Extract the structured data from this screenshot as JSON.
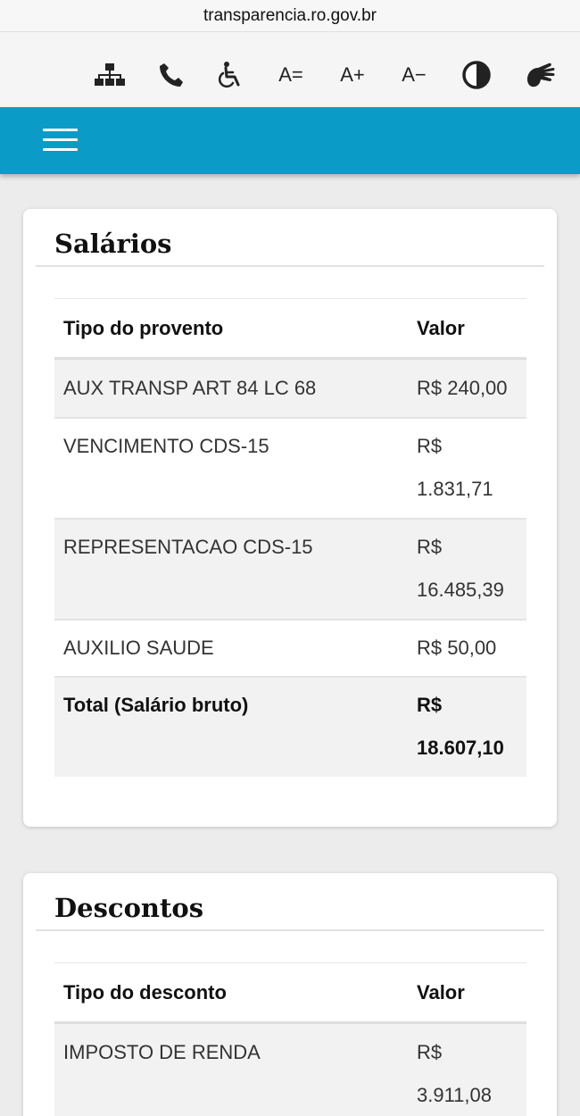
{
  "browser": {
    "url": "transparencia.ro.gov.br"
  },
  "accessibility_bar": {
    "font_reset": "A=",
    "font_increase": "A+",
    "font_decrease": "A−"
  },
  "salarios": {
    "title": "Salários",
    "columns": [
      "Tipo do provento",
      "Valor"
    ],
    "rows": [
      {
        "tipo": "AUX TRANSP ART 84 LC 68",
        "valor": "R$ 240,00"
      },
      {
        "tipo": "VENCIMENTO CDS-15",
        "valor": "R$ 1.831,71"
      },
      {
        "tipo": "REPRESENTACAO CDS-15",
        "valor": "R$ 16.485,39"
      },
      {
        "tipo": "AUXILIO SAUDE",
        "valor": "R$ 50,00"
      }
    ],
    "total": {
      "label": "Total (Salário bruto)",
      "valor": "R$ 18.607,10"
    }
  },
  "descontos": {
    "title": "Descontos",
    "columns": [
      "Tipo do desconto",
      "Valor"
    ],
    "rows": [
      {
        "tipo": "IMPOSTO DE RENDA",
        "valor": "R$ 3.911,08"
      }
    ]
  },
  "colors": {
    "navbar": "#0a9cc6",
    "page_background": "#ececec",
    "stripe": "#f2f2f2"
  }
}
